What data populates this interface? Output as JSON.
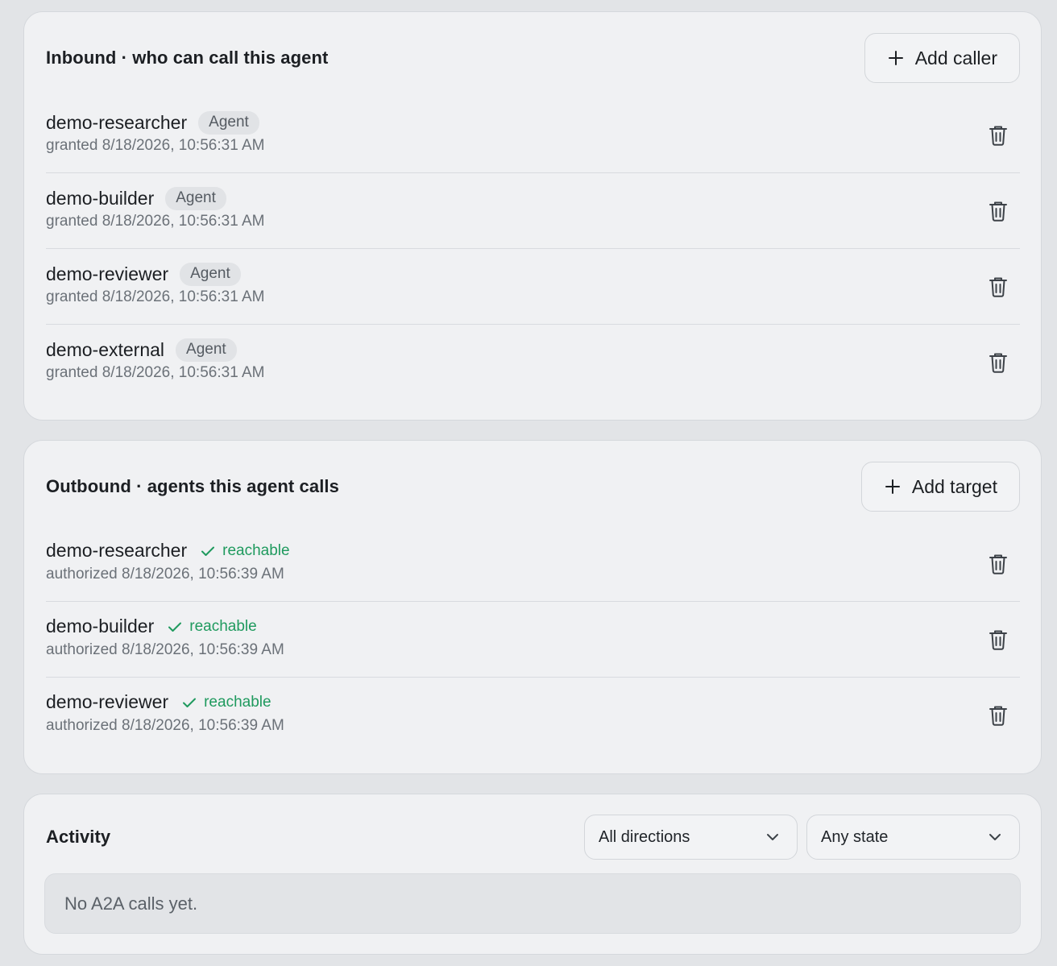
{
  "inbound": {
    "title": "Inbound · who can call this agent",
    "add_label": "Add caller",
    "items": [
      {
        "name": "demo-researcher",
        "badge": "Agent",
        "sub": "granted 8/18/2026, 10:56:31 AM"
      },
      {
        "name": "demo-builder",
        "badge": "Agent",
        "sub": "granted 8/18/2026, 10:56:31 AM"
      },
      {
        "name": "demo-reviewer",
        "badge": "Agent",
        "sub": "granted 8/18/2026, 10:56:31 AM"
      },
      {
        "name": "demo-external",
        "badge": "Agent",
        "sub": "granted 8/18/2026, 10:56:31 AM"
      }
    ]
  },
  "outbound": {
    "title": "Outbound · agents this agent calls",
    "add_label": "Add target",
    "items": [
      {
        "name": "demo-researcher",
        "status": "reachable",
        "sub": "authorized 8/18/2026, 10:56:39 AM"
      },
      {
        "name": "demo-builder",
        "status": "reachable",
        "sub": "authorized 8/18/2026, 10:56:39 AM"
      },
      {
        "name": "demo-reviewer",
        "status": "reachable",
        "sub": "authorized 8/18/2026, 10:56:39 AM"
      }
    ]
  },
  "activity": {
    "title": "Activity",
    "direction_filter": "All directions",
    "state_filter": "Any state",
    "empty_text": "No A2A calls yet."
  },
  "colors": {
    "background": "#e2e4e7",
    "card": "#f0f1f3",
    "reachable": "#1f9a5e"
  },
  "icons": {
    "add": "plus-icon",
    "delete": "trash-icon",
    "status": "check-icon",
    "dropdown": "chevron-down-icon"
  }
}
